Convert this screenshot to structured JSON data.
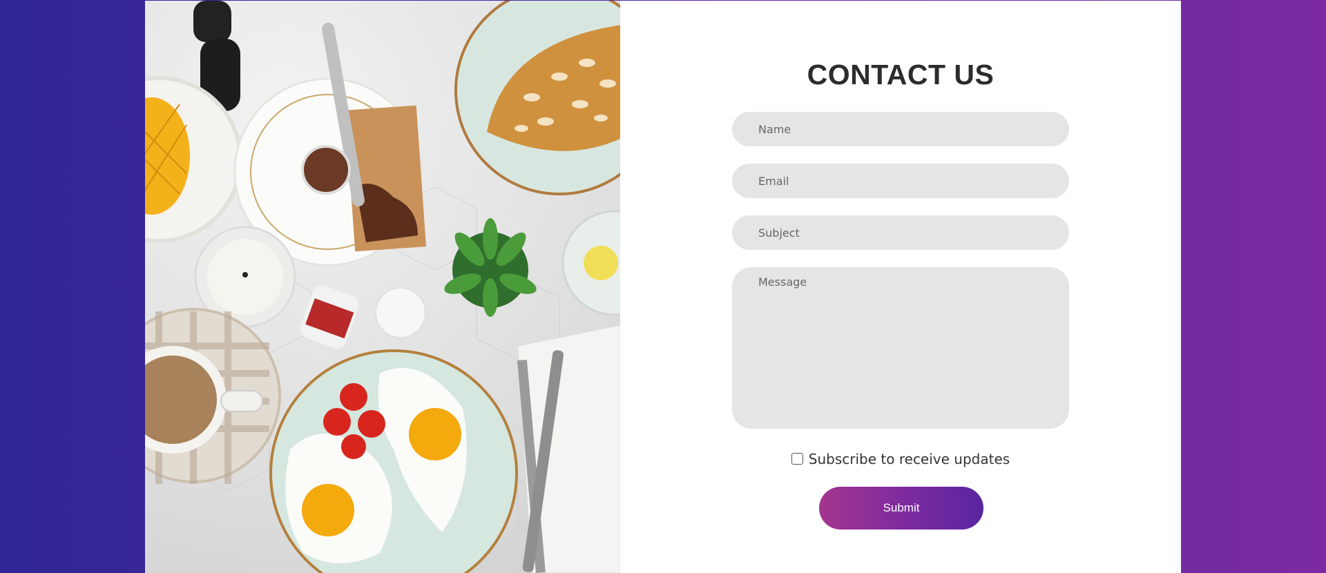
{
  "colors": {
    "background_gradient": [
      "#2f2596",
      "#7b2aa2"
    ],
    "card": "#ffffff",
    "field_bg": "#e5e5e5",
    "submit_gradient": [
      "#a4368f",
      "#5a25a0"
    ],
    "title": "#2c2c2c"
  },
  "image": {
    "icon": "breakfast-table-photo"
  },
  "form": {
    "title": "CONTACT US",
    "name_placeholder": "Name",
    "email_placeholder": "Email",
    "subject_placeholder": "Subject",
    "message_placeholder": "Message",
    "subscribe_label": "Subscribe to receive updates",
    "subscribe_checked": false,
    "submit_label": "Submit"
  }
}
